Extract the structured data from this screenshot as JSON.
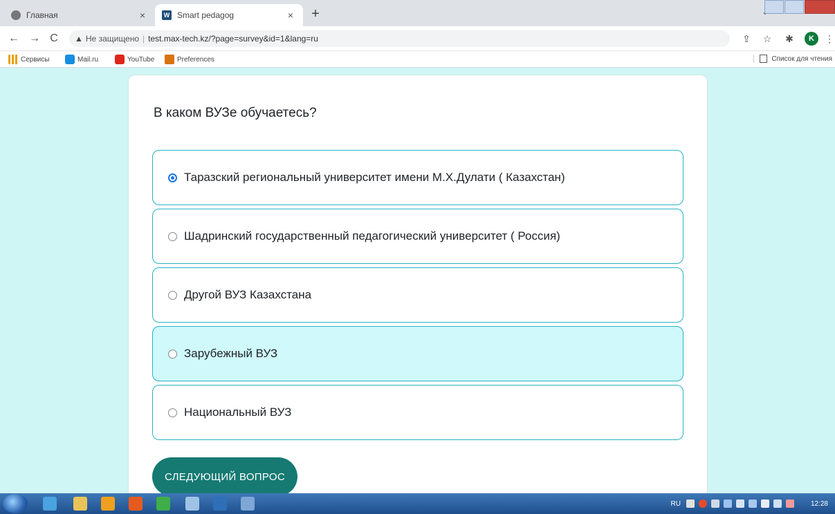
{
  "browser": {
    "tabs": [
      {
        "title": "Главная",
        "active": false
      },
      {
        "title": "Smart pedagog",
        "active": true
      }
    ],
    "new_tab": "+",
    "nav": {
      "back": "←",
      "forward": "→",
      "reload": "C"
    },
    "address": {
      "security_label": "Не защищено",
      "url": "test.max-tech.kz/?page=survey&id=1&lang=ru"
    },
    "profile_initial": "K",
    "bookmarks": [
      "Сервисы",
      "Mail.ru",
      "YouTube",
      "Preferences"
    ],
    "reading_list": "Список для чтения"
  },
  "survey": {
    "question": "В каком ВУЗе обучаетесь?",
    "options": [
      {
        "label": "Таразский региональный университет имени М.Х.Дулати ( Казахстан)",
        "selected": true
      },
      {
        "label": "Шадринский государственный педагогический университет ( Россия)",
        "selected": false
      },
      {
        "label": "Другой ВУЗ Казахстана",
        "selected": false
      },
      {
        "label": "Зарубежный ВУЗ",
        "selected": false
      },
      {
        "label": "Национальный ВУЗ",
        "selected": false
      }
    ],
    "next_button": "СЛЕДУЮЩИЙ ВОПРОС"
  },
  "taskbar": {
    "language": "RU",
    "clock": "12:28"
  },
  "colors": {
    "page_background": "#d0f5f5",
    "option_border": "#27b3c3",
    "option_hover": "#cff9fb",
    "button": "#167a72"
  }
}
